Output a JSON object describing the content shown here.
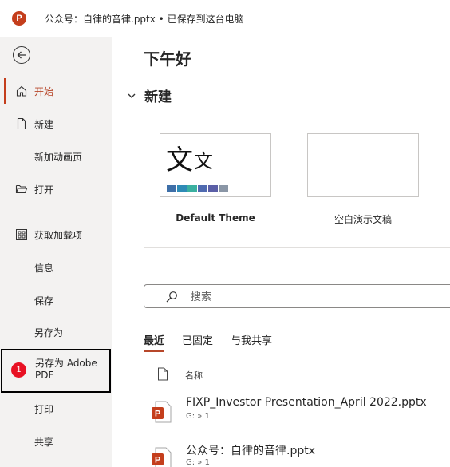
{
  "titlebar": {
    "app_icon_letter": "P",
    "title": "公众号：自律的音律.pptx • 已保存到这台电脑"
  },
  "sidebar": {
    "items": [
      {
        "label": "开始"
      },
      {
        "label": "新建"
      },
      {
        "label": "新加动画页"
      },
      {
        "label": "打开"
      },
      {
        "label": "获取加载项"
      },
      {
        "label": "信息"
      },
      {
        "label": "保存"
      },
      {
        "label": "另存为"
      },
      {
        "label": "另存为 Adobe PDF",
        "badge": "1"
      },
      {
        "label": "打印"
      },
      {
        "label": "共享"
      }
    ]
  },
  "main": {
    "greeting": "下午好",
    "new_section": "新建",
    "templates": [
      {
        "label": "Default Theme",
        "thumb_big": "文",
        "thumb_small": "文"
      },
      {
        "label": "空白演示文稿"
      }
    ],
    "swatch_colors": [
      "#3e6fa8",
      "#2f8bb6",
      "#3bb0a0",
      "#4f6ab0",
      "#5b5fa7",
      "#8a96a6"
    ],
    "search": {
      "placeholder": "搜索"
    },
    "tabs": [
      {
        "label": "最近"
      },
      {
        "label": "已固定"
      },
      {
        "label": "与我共享"
      }
    ],
    "column_name": "名称",
    "files": [
      {
        "name": "FIXP_Investor Presentation_April 2022.pptx",
        "path": "G: » 1"
      },
      {
        "name": "公众号：自律的音律.pptx",
        "path": "G: » 1"
      }
    ]
  },
  "colors": {
    "accent": "#c43e1c",
    "badge": "#e81123",
    "sidebar_bg": "#f3f2f1"
  }
}
